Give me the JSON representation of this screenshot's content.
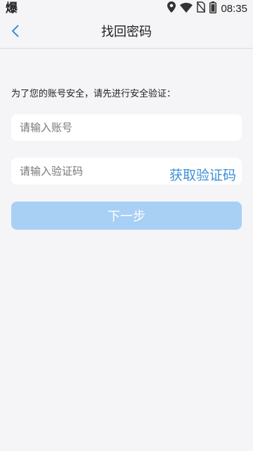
{
  "status_bar": {
    "app_icon_glyph": "爆",
    "time": "08:35",
    "icons": [
      "location-icon",
      "wifi-icon",
      "no-sim-icon",
      "battery-icon"
    ]
  },
  "header": {
    "title": "找回密码",
    "back_icon": "chevron-left-icon"
  },
  "form": {
    "hint": "为了您的账号安全，请先进行安全验证：",
    "account_placeholder": "请输入账号",
    "account_value": "",
    "code_placeholder": "请输入验证码",
    "code_value": "",
    "get_code_label": "获取验证码",
    "next_label": "下一步"
  },
  "colors": {
    "accent": "#3d8fd8",
    "button_disabled": "#a8cff4",
    "background": "#f5f5f7",
    "field_background": "#ffffff"
  }
}
